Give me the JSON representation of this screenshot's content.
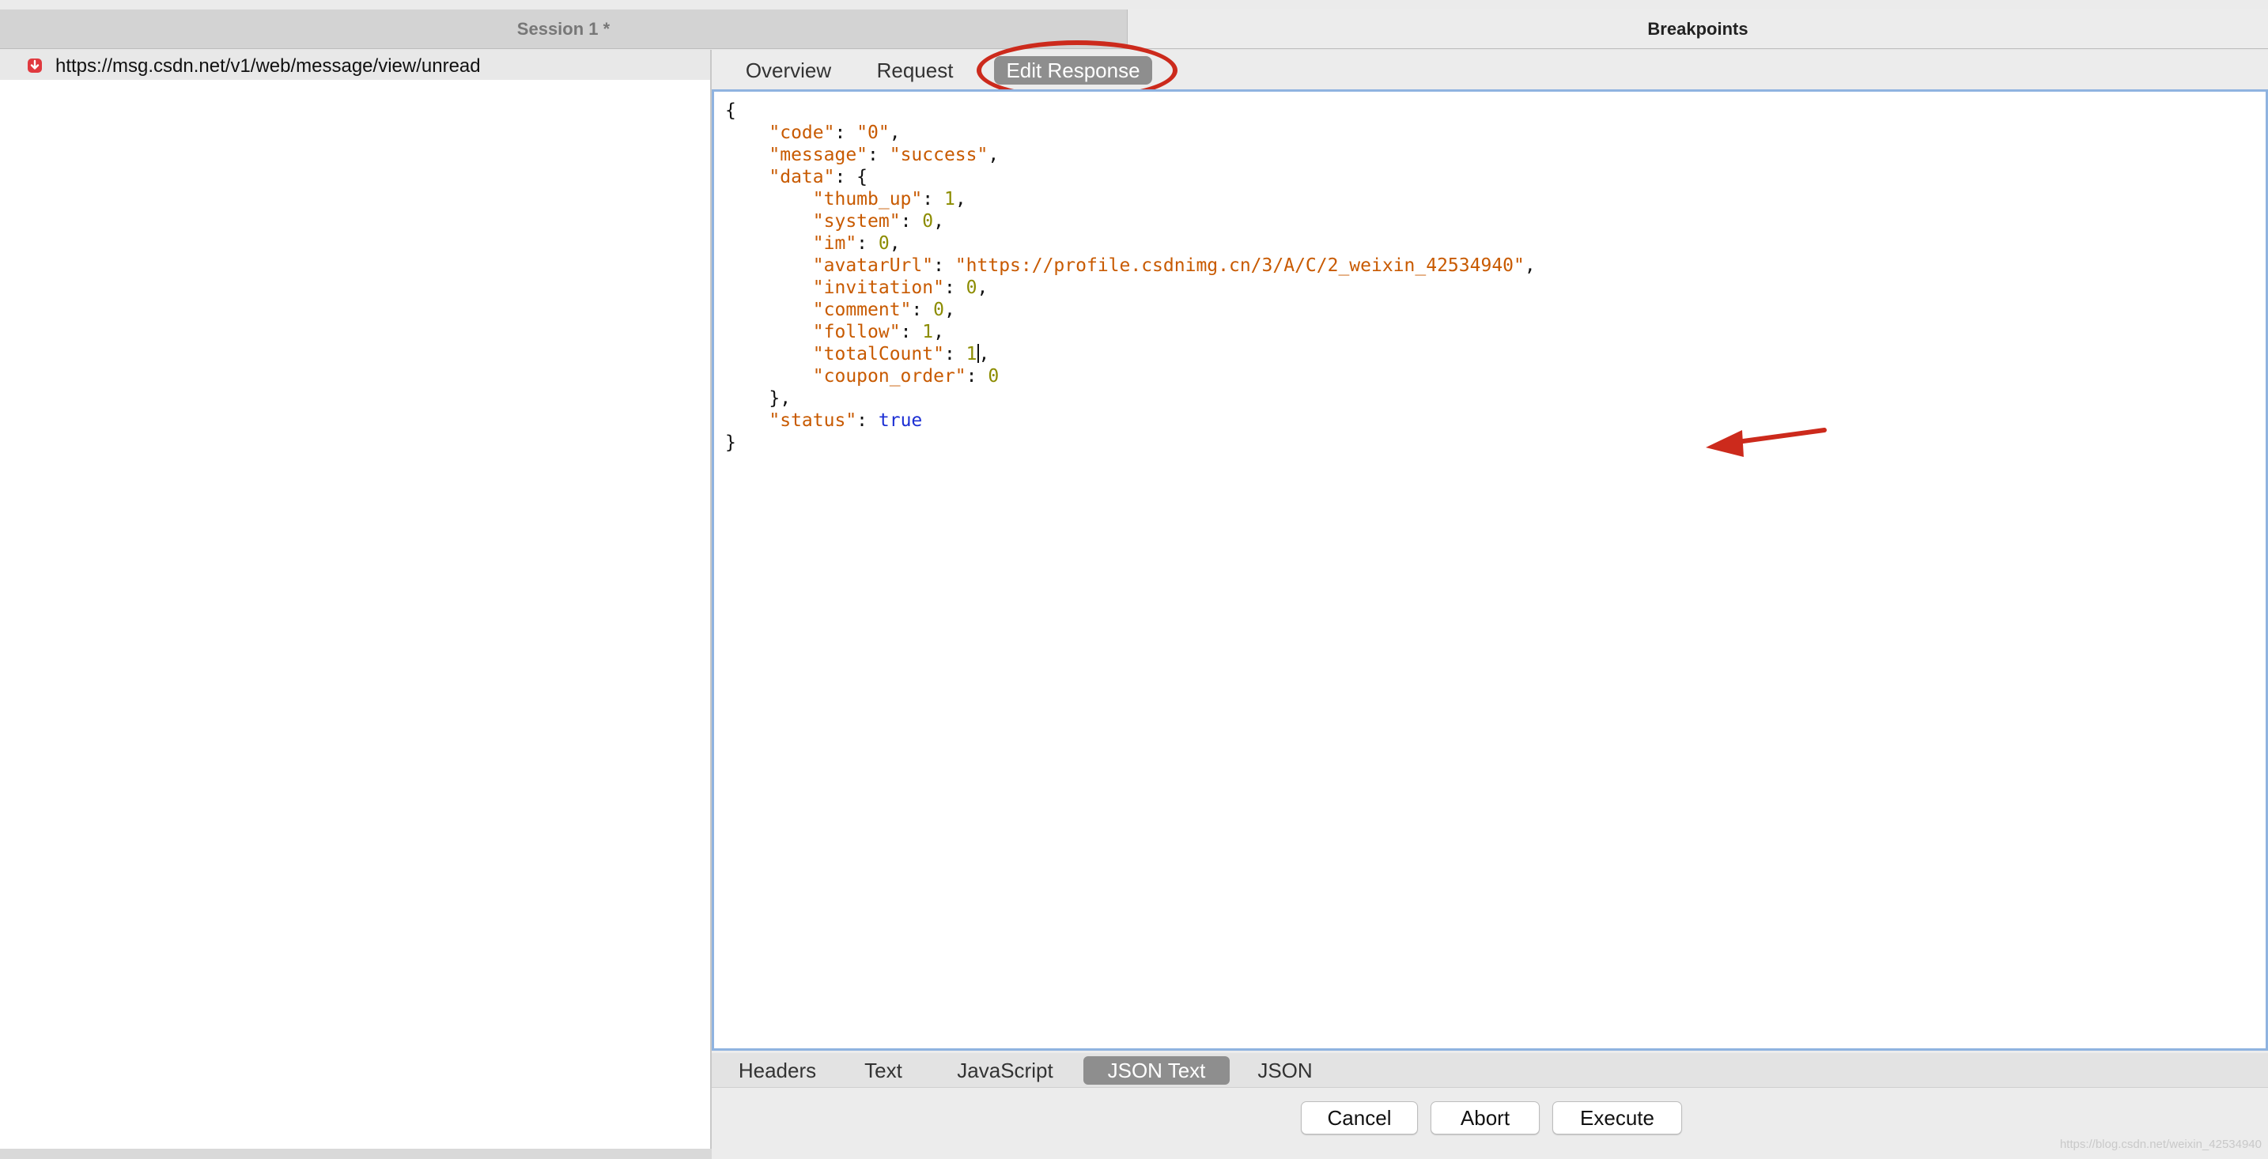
{
  "tabs": {
    "session": "Session 1 *",
    "breakpoints": "Breakpoints"
  },
  "request": {
    "url": "https://msg.csdn.net/v1/web/message/view/unread"
  },
  "top_tabs": [
    "Overview",
    "Request",
    "Edit Response"
  ],
  "json_lines": [
    {
      "i": "",
      "t": [
        [
          "p",
          "{"
        ]
      ]
    },
    {
      "i": "    ",
      "t": [
        [
          "k",
          "\"code\""
        ],
        [
          "p",
          ": "
        ],
        [
          "s",
          "\"0\""
        ],
        [
          "p",
          ","
        ]
      ]
    },
    {
      "i": "    ",
      "t": [
        [
          "k",
          "\"message\""
        ],
        [
          "p",
          ": "
        ],
        [
          "s",
          "\"success\""
        ],
        [
          "p",
          ","
        ]
      ]
    },
    {
      "i": "    ",
      "t": [
        [
          "k",
          "\"data\""
        ],
        [
          "p",
          ": {"
        ]
      ]
    },
    {
      "i": "        ",
      "t": [
        [
          "k",
          "\"thumb_up\""
        ],
        [
          "p",
          ": "
        ],
        [
          "n",
          "1"
        ],
        [
          "p",
          ","
        ]
      ]
    },
    {
      "i": "        ",
      "t": [
        [
          "k",
          "\"system\""
        ],
        [
          "p",
          ": "
        ],
        [
          "n",
          "0"
        ],
        [
          "p",
          ","
        ]
      ]
    },
    {
      "i": "        ",
      "t": [
        [
          "k",
          "\"im\""
        ],
        [
          "p",
          ": "
        ],
        [
          "n",
          "0"
        ],
        [
          "p",
          ","
        ]
      ]
    },
    {
      "i": "        ",
      "t": [
        [
          "k",
          "\"avatarUrl\""
        ],
        [
          "p",
          ": "
        ],
        [
          "s",
          "\"https://profile.csdnimg.cn/3/A/C/2_weixin_42534940\""
        ],
        [
          "p",
          ","
        ]
      ]
    },
    {
      "i": "        ",
      "t": [
        [
          "k",
          "\"invitation\""
        ],
        [
          "p",
          ": "
        ],
        [
          "n",
          "0"
        ],
        [
          "p",
          ","
        ]
      ]
    },
    {
      "i": "        ",
      "t": [
        [
          "k",
          "\"comment\""
        ],
        [
          "p",
          ": "
        ],
        [
          "n",
          "0"
        ],
        [
          "p",
          ","
        ]
      ]
    },
    {
      "i": "        ",
      "t": [
        [
          "k",
          "\"follow\""
        ],
        [
          "p",
          ": "
        ],
        [
          "n",
          "1"
        ],
        [
          "p",
          ","
        ]
      ]
    },
    {
      "i": "        ",
      "t": [
        [
          "k",
          "\"totalCount\""
        ],
        [
          "p",
          ": "
        ],
        [
          "n",
          "1"
        ],
        [
          "c",
          ""
        ],
        [
          "p",
          ","
        ]
      ]
    },
    {
      "i": "        ",
      "t": [
        [
          "k",
          "\"coupon_order\""
        ],
        [
          "p",
          ": "
        ],
        [
          "n",
          "0"
        ]
      ]
    },
    {
      "i": "    ",
      "t": [
        [
          "p",
          "},"
        ]
      ]
    },
    {
      "i": "    ",
      "t": [
        [
          "k",
          "\"status\""
        ],
        [
          "p",
          ": "
        ],
        [
          "b",
          "true"
        ]
      ]
    },
    {
      "i": "",
      "t": [
        [
          "p",
          "}"
        ]
      ]
    }
  ],
  "bottom_tabs": [
    "Headers",
    "Text",
    "JavaScript",
    "JSON Text",
    "JSON"
  ],
  "buttons": {
    "cancel": "Cancel",
    "abort": "Abort",
    "execute": "Execute"
  },
  "watermark": "https://blog.csdn.net/weixin_42534940",
  "colors": {
    "annotation": "#cc2a1c",
    "json_key": "#c85a00",
    "json_number": "#8c8c00",
    "json_bool": "#1c2fd4",
    "selected_tab": "#8e8e8e"
  }
}
